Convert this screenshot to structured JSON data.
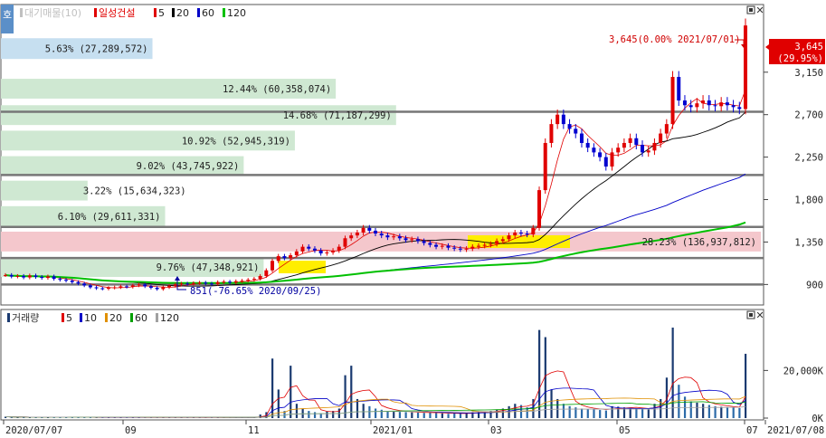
{
  "header": {
    "stock_label": "대기매물(10)",
    "stock_name": "일성건설",
    "ma_labels": [
      "5",
      "20",
      "60",
      "120"
    ],
    "ma_colors": [
      "#e00000",
      "#000000",
      "#0000c8",
      "#00c000"
    ],
    "corner_icon": "vertical-text-icon",
    "corner_text": "호"
  },
  "volume_header": {
    "label": "거래량",
    "ma_labels": [
      "5",
      "10",
      "20",
      "60",
      "120"
    ],
    "ma_colors": [
      "#e00000",
      "#0000c8",
      "#e09000",
      "#00a000",
      "#a0a0a0"
    ]
  },
  "price_axis": {
    "ticks": [
      "3,150",
      "2,700",
      "2,250",
      "1,800",
      "1,350",
      "900"
    ]
  },
  "volume_axis": {
    "ticks": [
      "20,000K",
      "0K"
    ]
  },
  "date_axis": {
    "labels": [
      "2020/07/07",
      "09",
      "11",
      "2021/01",
      "03",
      "05",
      "07",
      "2021/07/08"
    ]
  },
  "annotations": {
    "high_label": "3,645(0.00% 2021/07/01)",
    "low_label": "851(-76.65% 2020/09/25)",
    "current_price": "3,645",
    "current_change": "(29.95%)"
  },
  "chart_data": {
    "type": "candlestick",
    "price_range": [
      750,
      3800
    ],
    "volume_range_k": [
      0,
      38000
    ],
    "supply_zones": [
      {
        "label": "5.63% (27,289,572)",
        "pct": 5.63,
        "volume": 27289572,
        "price_from": 3290,
        "price_to": 3510,
        "color": "#c6dff0"
      },
      {
        "label": "12.44% (60,358,074)",
        "pct": 12.44,
        "volume": 60358074,
        "price_from": 2870,
        "price_to": 3080,
        "color": "#cfe8d2"
      },
      {
        "label": "14.68% (71,187,299)",
        "pct": 14.68,
        "volume": 71187299,
        "price_from": 2590,
        "price_to": 2800,
        "color": "#cfe8d2"
      },
      {
        "label": "10.92% (52,945,319)",
        "pct": 10.92,
        "volume": 52945319,
        "price_from": 2320,
        "price_to": 2530,
        "color": "#cfe8d2"
      },
      {
        "label": "9.02% (43,745,922)",
        "pct": 9.02,
        "volume": 43745922,
        "price_from": 2060,
        "price_to": 2260,
        "color": "#cfe8d2"
      },
      {
        "label": "3.22% (15,634,323)",
        "pct": 3.22,
        "volume": 15634323,
        "price_from": 1790,
        "price_to": 2000,
        "color": "#cfe8d2"
      },
      {
        "label": "6.10% (29,611,331)",
        "pct": 6.1,
        "volume": 29611331,
        "price_from": 1520,
        "price_to": 1730,
        "color": "#cfe8d2"
      },
      {
        "label": "28.23% (136,937,812)",
        "pct": 28.23,
        "volume": 136937812,
        "price_from": 1250,
        "price_to": 1460,
        "color": "#f4c7cc"
      },
      {
        "label": "9.76% (47,348,921)",
        "pct": 9.76,
        "volume": 47348921,
        "price_from": 980,
        "price_to": 1190,
        "color": "#cfe8d2"
      }
    ],
    "horizontal_levels": [
      2730,
      2060,
      1510,
      1180,
      900
    ],
    "close_series": [
      1000,
      985,
      990,
      975,
      995,
      980,
      970,
      985,
      960,
      950,
      940,
      925,
      910,
      890,
      870,
      860,
      855,
      865,
      870,
      880,
      875,
      890,
      900,
      880,
      865,
      851,
      870,
      885,
      900,
      910,
      905,
      915,
      920,
      910,
      905,
      925,
      930,
      920,
      935,
      940,
      950,
      960,
      990,
      1050,
      1150,
      1200,
      1180,
      1210,
      1250,
      1300,
      1280,
      1260,
      1230,
      1240,
      1260,
      1300,
      1390,
      1420,
      1450,
      1500,
      1470,
      1440,
      1420,
      1400,
      1410,
      1390,
      1370,
      1380,
      1360,
      1340,
      1320,
      1300,
      1310,
      1290,
      1280,
      1270,
      1280,
      1300,
      1310,
      1320,
      1330,
      1360,
      1380,
      1420,
      1450,
      1440,
      1430,
      1500,
      1900,
      2400,
      2600,
      2700,
      2600,
      2550,
      2500,
      2400,
      2350,
      2300,
      2250,
      2150,
      2300,
      2350,
      2400,
      2450,
      2380,
      2300,
      2320,
      2400,
      2500,
      2600,
      3100,
      2850,
      2800,
      2780,
      2820,
      2850,
      2800,
      2790,
      2830,
      2800,
      2780,
      2760,
      3645
    ],
    "volume_k": [
      600,
      400,
      350,
      500,
      300,
      450,
      400,
      350,
      300,
      350,
      400,
      300,
      250,
      300,
      350,
      300,
      250,
      300,
      280,
      320,
      300,
      250,
      300,
      280,
      260,
      300,
      280,
      260,
      300,
      250,
      300,
      280,
      260,
      250,
      300,
      280,
      260,
      250,
      240,
      260,
      280,
      300,
      1500,
      2500,
      25000,
      12000,
      3000,
      22000,
      6000,
      4000,
      3000,
      2500,
      2000,
      2800,
      3000,
      4000,
      18000,
      22000,
      8000,
      6000,
      5000,
      4000,
      3500,
      3000,
      2800,
      2600,
      2500,
      2400,
      2300,
      2200,
      2400,
      2200,
      2000,
      1800,
      1900,
      2000,
      2200,
      2400,
      2600,
      2800,
      3000,
      3500,
      4000,
      5000,
      6000,
      5500,
      4500,
      8000,
      37000,
      34000,
      12000,
      8000,
      6000,
      5000,
      4500,
      4000,
      3800,
      3600,
      3400,
      3200,
      5000,
      4800,
      4500,
      4200,
      4000,
      3800,
      3600,
      6000,
      8000,
      17000,
      38000,
      14000,
      9000,
      7000,
      6500,
      6000,
      5500,
      5000,
      4800,
      4600,
      4400,
      4200,
      27000
    ]
  }
}
